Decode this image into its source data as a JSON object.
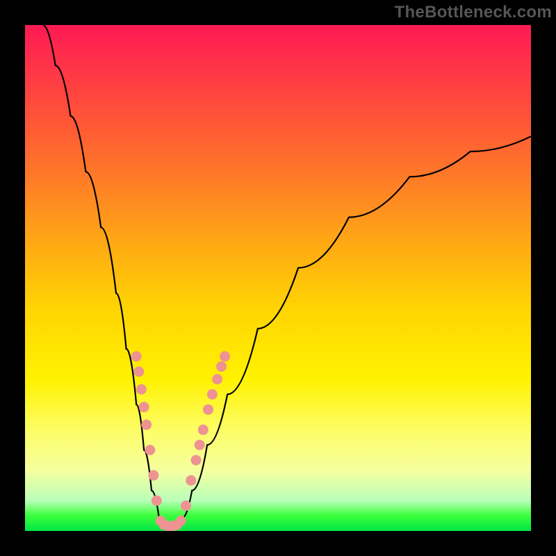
{
  "credit": "TheBottleneck.com",
  "chart_data": {
    "type": "line",
    "title": "",
    "xlabel": "",
    "ylabel": "",
    "xlim": [
      0,
      100
    ],
    "ylim": [
      0,
      100
    ],
    "curve": [
      {
        "x": 3.5,
        "y": 100
      },
      {
        "x": 6,
        "y": 92
      },
      {
        "x": 9,
        "y": 82
      },
      {
        "x": 12,
        "y": 71
      },
      {
        "x": 15,
        "y": 60
      },
      {
        "x": 18,
        "y": 47
      },
      {
        "x": 20,
        "y": 36
      },
      {
        "x": 22,
        "y": 25
      },
      {
        "x": 23.5,
        "y": 16
      },
      {
        "x": 25,
        "y": 8
      },
      {
        "x": 26.5,
        "y": 2.5
      },
      {
        "x": 28,
        "y": 1
      },
      {
        "x": 29.5,
        "y": 1
      },
      {
        "x": 31,
        "y": 2.5
      },
      {
        "x": 33,
        "y": 8
      },
      {
        "x": 36,
        "y": 17
      },
      {
        "x": 40,
        "y": 27
      },
      {
        "x": 46,
        "y": 40
      },
      {
        "x": 54,
        "y": 52
      },
      {
        "x": 64,
        "y": 62
      },
      {
        "x": 76,
        "y": 70
      },
      {
        "x": 88,
        "y": 75
      },
      {
        "x": 100,
        "y": 78
      }
    ],
    "dots": [
      {
        "x": 22.0,
        "y": 34.5
      },
      {
        "x": 22.5,
        "y": 31.5
      },
      {
        "x": 23.0,
        "y": 28.0
      },
      {
        "x": 23.5,
        "y": 24.5
      },
      {
        "x": 24.0,
        "y": 21.0
      },
      {
        "x": 24.7,
        "y": 16.0
      },
      {
        "x": 25.4,
        "y": 11.0
      },
      {
        "x": 26.0,
        "y": 6.0
      },
      {
        "x": 26.8,
        "y": 2.0
      },
      {
        "x": 27.5,
        "y": 1.2
      },
      {
        "x": 28.3,
        "y": 1.0
      },
      {
        "x": 29.2,
        "y": 1.0
      },
      {
        "x": 30.0,
        "y": 1.2
      },
      {
        "x": 30.8,
        "y": 2.0
      },
      {
        "x": 31.8,
        "y": 5.0
      },
      {
        "x": 32.8,
        "y": 10.0
      },
      {
        "x": 33.8,
        "y": 14.0
      },
      {
        "x": 34.5,
        "y": 17.0
      },
      {
        "x": 35.2,
        "y": 20.0
      },
      {
        "x": 36.2,
        "y": 24.0
      },
      {
        "x": 37.0,
        "y": 27.0
      },
      {
        "x": 38.0,
        "y": 30.0
      },
      {
        "x": 38.8,
        "y": 32.5
      },
      {
        "x": 39.5,
        "y": 34.5
      }
    ],
    "dot_radius_px": 7.5,
    "background_gradient": {
      "top": "#ff1a54",
      "mid": "#fff200",
      "bottom": "#00e646"
    }
  }
}
